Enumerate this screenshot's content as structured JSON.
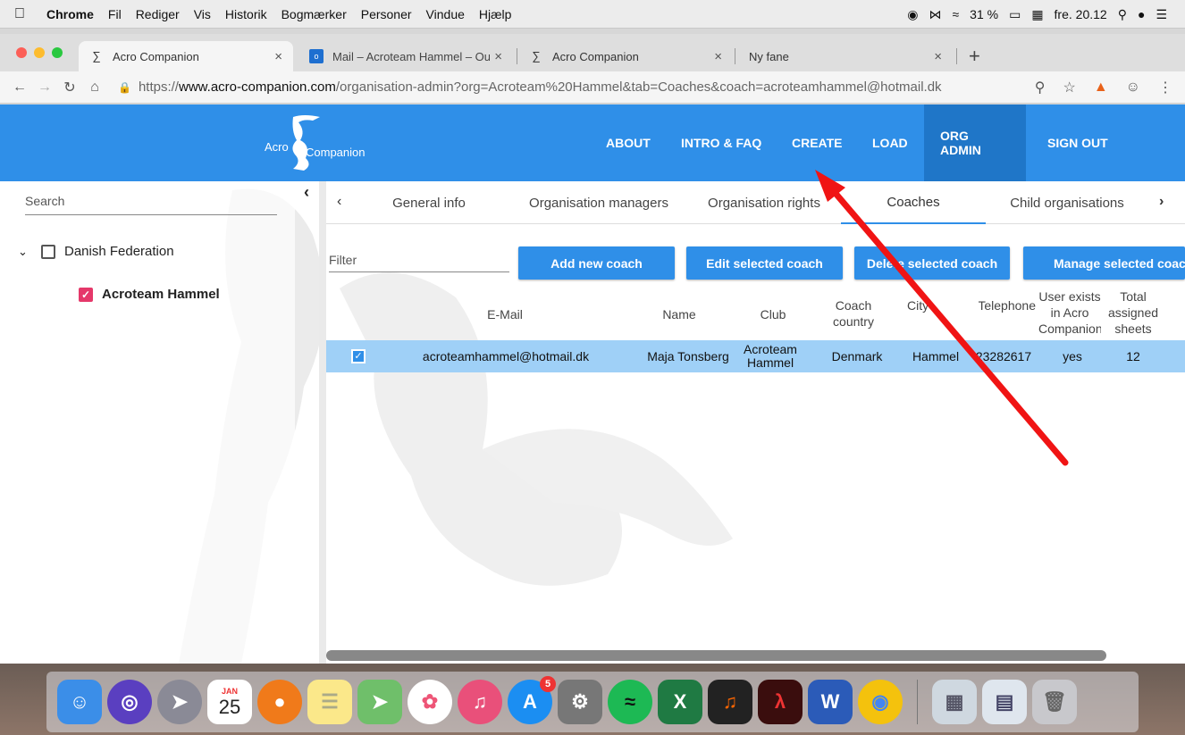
{
  "menubar": {
    "items": [
      "Chrome",
      "Fil",
      "Rediger",
      "Vis",
      "Historik",
      "Bogmærker",
      "Personer",
      "Vindue",
      "Hjælp"
    ],
    "battery": "31 %",
    "clock": "fre. 20.12"
  },
  "browser": {
    "tabs": [
      {
        "title": "Acro Companion"
      },
      {
        "title": "Mail – Acroteam Hammel – Out"
      },
      {
        "title": "Acro Companion"
      },
      {
        "title": "Ny fane"
      }
    ],
    "url_prefix": "https://",
    "url_host": "www.acro-companion.com",
    "url_path": "/organisation-admin?org=Acroteam%20Hammel&tab=Coaches&coach=acroteamhammel@hotmail.dk"
  },
  "app": {
    "logo_left": "Acro",
    "logo_right": "Companion",
    "nav": [
      "ABOUT",
      "INTRO & FAQ",
      "CREATE",
      "LOAD",
      "ORG ADMIN",
      "SIGN OUT"
    ]
  },
  "sidebar": {
    "search_placeholder": "Search",
    "tree": [
      {
        "label": "Danish Federation"
      },
      {
        "label": "Acroteam Hammel"
      }
    ]
  },
  "main": {
    "tabs": [
      "General info",
      "Organisation managers",
      "Organisation rights",
      "Coaches",
      "Child organisations"
    ],
    "filter_placeholder": "Filter",
    "buttons": [
      "Add new coach",
      "Edit selected coach",
      "Delete selected coach",
      "Manage selected coach"
    ],
    "columns": [
      "E-Mail",
      "Name",
      "Club",
      "Coach country",
      "City",
      "Telephone",
      "User exists in Acro Companion",
      "Total assigned sheets"
    ],
    "rows": [
      {
        "email": "acroteamhammel@hotmail.dk",
        "name": "Maja Tonsberg",
        "club": "Acroteam Hammel",
        "country": "Denmark",
        "city": "Hammel",
        "telephone": "23282617",
        "exists": "yes",
        "sheets": "12"
      }
    ]
  },
  "dock": {
    "calendar_month": "JAN",
    "calendar_day": "25",
    "appstore_badge": "5"
  }
}
